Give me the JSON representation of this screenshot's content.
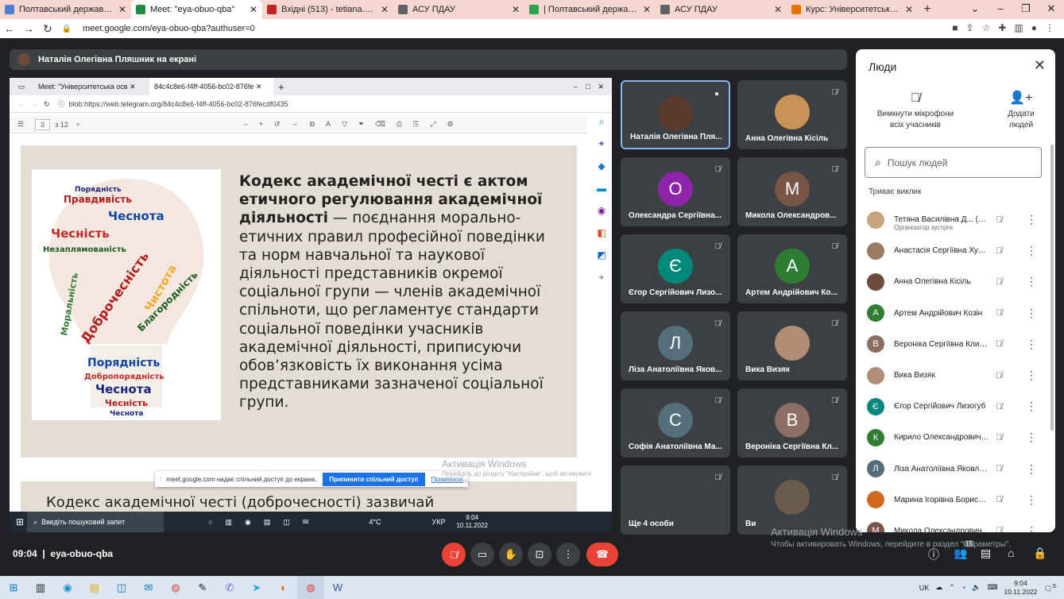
{
  "browser_tabs": [
    {
      "title": "Полтавський державний аграр",
      "fav": "#4a7fd1"
    },
    {
      "title": "Meet: \"eya-obuo-qba\"",
      "fav": "#1e8e3e",
      "active": true
    },
    {
      "title": "Вхідні (513) - tetiana.diadyk@p",
      "fav": "#c5221f"
    },
    {
      "title": "АСУ ПДАУ",
      "fav": "#5f6368"
    },
    {
      "title": "| Полтавський державний агра",
      "fav": "#2ea44f"
    },
    {
      "title": "АСУ ПДАУ",
      "fav": "#5f6368"
    },
    {
      "title": "Курс: Університетська освіта_",
      "fav": "#e37400"
    }
  ],
  "url": "meet.google.com/eya-obuo-qba?authuser=0",
  "presenting_label": "Наталія Олегівна Пляшник на екрані",
  "shared": {
    "inner_tabs": [
      "Meet: \"Університетська осв",
      "84c4c8e6-f4ff-4056-bc02-876fe"
    ],
    "inner_url": "blob:https://web.telegram.org/84c4c8e6-f4ff-4056-bc02-876fecdf0435",
    "page_num": "3",
    "page_total": "з 12",
    "slide_bold": "Кодекс академічної честі є актом етичного регулювання академічної діяльності",
    "slide_rest": " — поєднання морально-етичних правил професійної поведінки та норм навчальної та наукової діяльності представників окремої соціальної групи — членів академічної спільноти, що регламентує стандарти соціальної поведінки учасників академічної діяльності, приписуючи обов’язковість їх виконання усіма представниками зазначеної соціальної групи.",
    "page2_text": "Кодекс академічної честі (доброчесності) зазвичай",
    "share_notice": "meet.google.com надає спільний доступ до екрана.",
    "stop_share": "Припинити спільний доступ",
    "hide": "Приховати",
    "win_activation": "Активація Windows",
    "win_activation_sub": "Перейдіть до розділу \"Настройки\", щоб активувати Windows.",
    "taskbar_search": "Введіть пошуковий запит",
    "taskbar_weather": "4°C",
    "taskbar_lang": "УКР",
    "taskbar_time": "9:04",
    "taskbar_date": "10.11.2022",
    "cloud_words": [
      "Порядність",
      "Правдивість",
      "Чесність",
      "Чеснота",
      "Незаплямованість",
      "Доброчесність",
      "Чистота",
      "Моральність",
      "Благородність",
      "Порядність",
      "Добропорядність",
      "Чеснота",
      "Чесність",
      "Чеснота"
    ]
  },
  "tiles": [
    {
      "name": "Наталія Олегівна Пля...",
      "initial": "",
      "color": "#5a3b2e",
      "speaking": true
    },
    {
      "name": "Анна Олегівна Кісіль",
      "initial": "",
      "color": "#c89455"
    },
    {
      "name": "Олександра Сергіївна...",
      "initial": "О",
      "color": "#8e24aa"
    },
    {
      "name": "Микола Олександров...",
      "initial": "М",
      "color": "#795548"
    },
    {
      "name": "Єгор Сергійович Лизо...",
      "initial": "Є",
      "color": "#00897b"
    },
    {
      "name": "Артем Андрійович Ко...",
      "initial": "А",
      "color": "#2e7d32"
    },
    {
      "name": "Ліза Анатоліївна Яков...",
      "initial": "Л",
      "color": "#546e7a"
    },
    {
      "name": "Вика Визяк",
      "initial": "",
      "color": "#b08d74"
    },
    {
      "name": "Софія Анатоліївна Ма...",
      "initial": "С",
      "color": "#546e7a"
    },
    {
      "name": "Вероніка Сергіївна Кл...",
      "initial": "В",
      "color": "#8d6e63"
    },
    {
      "name": "Ще 4 особи",
      "initial": "",
      "color": "#3c4043"
    },
    {
      "name": "Ви",
      "initial": "",
      "color": "#6b5b4b"
    }
  ],
  "people": {
    "title": "Люди",
    "mute_all": "Вимкнути мікрофони всіх учасників",
    "add": "Додати людей",
    "search_placeholder": "Пошук людей",
    "section": "Триває виклик",
    "list": [
      {
        "name": "Тетяна Василівна Д...  (Ви)",
        "sub": "Організатор зустрічі",
        "initial": "",
        "color": "#c9a27e"
      },
      {
        "name": "Анастасія Сергіївна Хурса",
        "initial": "",
        "color": "#9c7b63"
      },
      {
        "name": "Анна Олегівна Кісіль",
        "initial": "",
        "color": "#6d4c3d"
      },
      {
        "name": "Артем Андрійович Козін",
        "initial": "А",
        "color": "#2e7d32"
      },
      {
        "name": "Вероніка Сергіївна Клим...",
        "initial": "В",
        "color": "#8d6e63"
      },
      {
        "name": "Вика Визяк",
        "initial": "",
        "color": "#b08d74"
      },
      {
        "name": "Єгор Сергійович Лизогуб",
        "initial": "Є",
        "color": "#00897b"
      },
      {
        "name": "Кирило Олександрович ...",
        "initial": "К",
        "color": "#2e7d32"
      },
      {
        "name": "Ліза Анатоліївна Яковлєва",
        "initial": "Л",
        "color": "#546e7a"
      },
      {
        "name": "Марина Ігорівна Борисо...",
        "initial": "",
        "color": "#d2691e"
      },
      {
        "name": "Микола Олександрович...",
        "initial": "М",
        "color": "#795548"
      }
    ]
  },
  "meeting": {
    "time": "09:04",
    "code": "eya-obuo-qba",
    "people_count": "15"
  },
  "activation": {
    "title": "Активація Windows",
    "sub": "Чтобы активировать Windows, перейдите в раздел \"Параметры\"."
  },
  "os": {
    "lang": "UK",
    "time": "9:04",
    "date": "10.11.2022",
    "notif": "5"
  }
}
